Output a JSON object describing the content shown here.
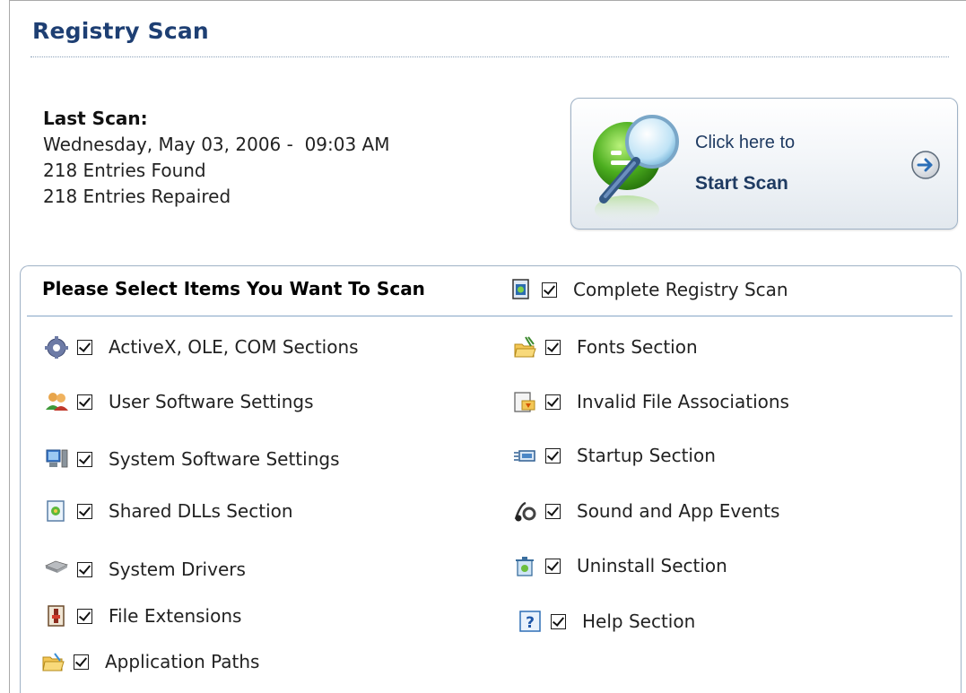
{
  "header": {
    "title": "Registry Scan"
  },
  "last_scan": {
    "label": "Last Scan:",
    "date": "Wednesday, May 03, 2006 -  09:03 AM",
    "entries_found": "218 Entries Found",
    "entries_repaired": "218 Entries Repaired"
  },
  "scan_button": {
    "line1": "Click here to",
    "line2": "Start Scan",
    "icon": "magnifier-icon"
  },
  "select": {
    "heading": "Please Select Items You Want To Scan",
    "complete": {
      "label": "Complete Registry Scan",
      "checked": true,
      "icon": "registry-icon"
    },
    "left_items": [
      {
        "label": "ActiveX, OLE, COM Sections",
        "checked": true,
        "icon": "gear-icon"
      },
      {
        "label": "User Software Settings",
        "checked": true,
        "icon": "users-icon"
      },
      {
        "label": "System Software Settings",
        "checked": true,
        "icon": "computer-icon"
      },
      {
        "label": "Shared DLLs Section",
        "checked": true,
        "icon": "dll-icon"
      },
      {
        "label": "System Drivers",
        "checked": true,
        "icon": "drive-icon"
      },
      {
        "label": "File Extensions",
        "checked": true,
        "icon": "file-extension-icon"
      },
      {
        "label": "Application Paths",
        "checked": true,
        "icon": "folder-icon"
      }
    ],
    "right_items": [
      {
        "label": "Fonts Section",
        "checked": true,
        "icon": "font-folder-icon"
      },
      {
        "label": "Invalid File Associations",
        "checked": true,
        "icon": "file-association-icon"
      },
      {
        "label": "Startup Section",
        "checked": true,
        "icon": "startup-icon"
      },
      {
        "label": "Sound and App Events",
        "checked": true,
        "icon": "sound-icon"
      },
      {
        "label": "Uninstall Section",
        "checked": true,
        "icon": "uninstall-icon"
      },
      {
        "label": "Help Section",
        "checked": true,
        "icon": "help-icon"
      }
    ]
  },
  "colors": {
    "title": "#1e3f73",
    "border": "#9fb2c6",
    "button_text": "#1f3b62"
  }
}
